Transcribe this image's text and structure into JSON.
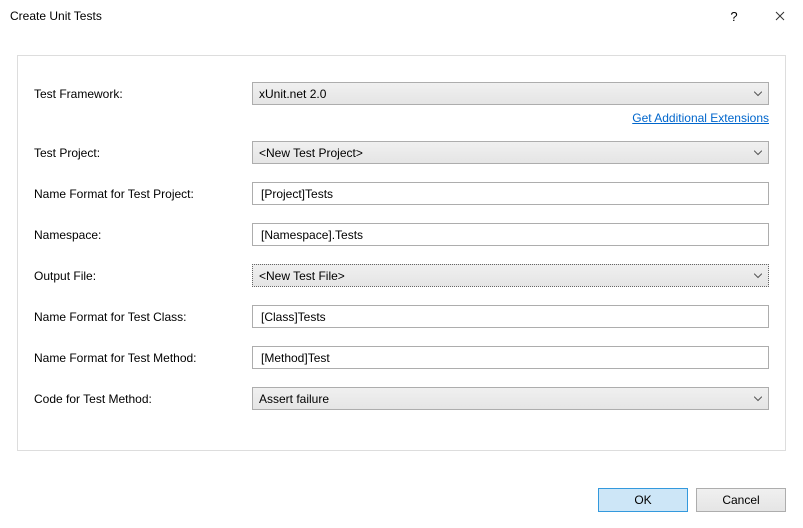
{
  "window": {
    "title": "Create Unit Tests"
  },
  "labels": {
    "test_framework": "Test Framework:",
    "test_project": "Test Project:",
    "name_format_project": "Name Format for Test Project:",
    "namespace": "Namespace:",
    "output_file": "Output File:",
    "name_format_class": "Name Format for Test Class:",
    "name_format_method": "Name Format for Test Method:",
    "code_for_method": "Code for Test Method:"
  },
  "values": {
    "test_framework": "xUnit.net 2.0",
    "test_project": "<New Test Project>",
    "name_format_project": "[Project]Tests",
    "namespace": "[Namespace].Tests",
    "output_file": "<New Test File>",
    "name_format_class": "[Class]Tests",
    "name_format_method": "[Method]Test",
    "code_for_method": "Assert failure"
  },
  "links": {
    "get_extensions": "Get Additional Extensions"
  },
  "buttons": {
    "ok": "OK",
    "cancel": "Cancel"
  }
}
